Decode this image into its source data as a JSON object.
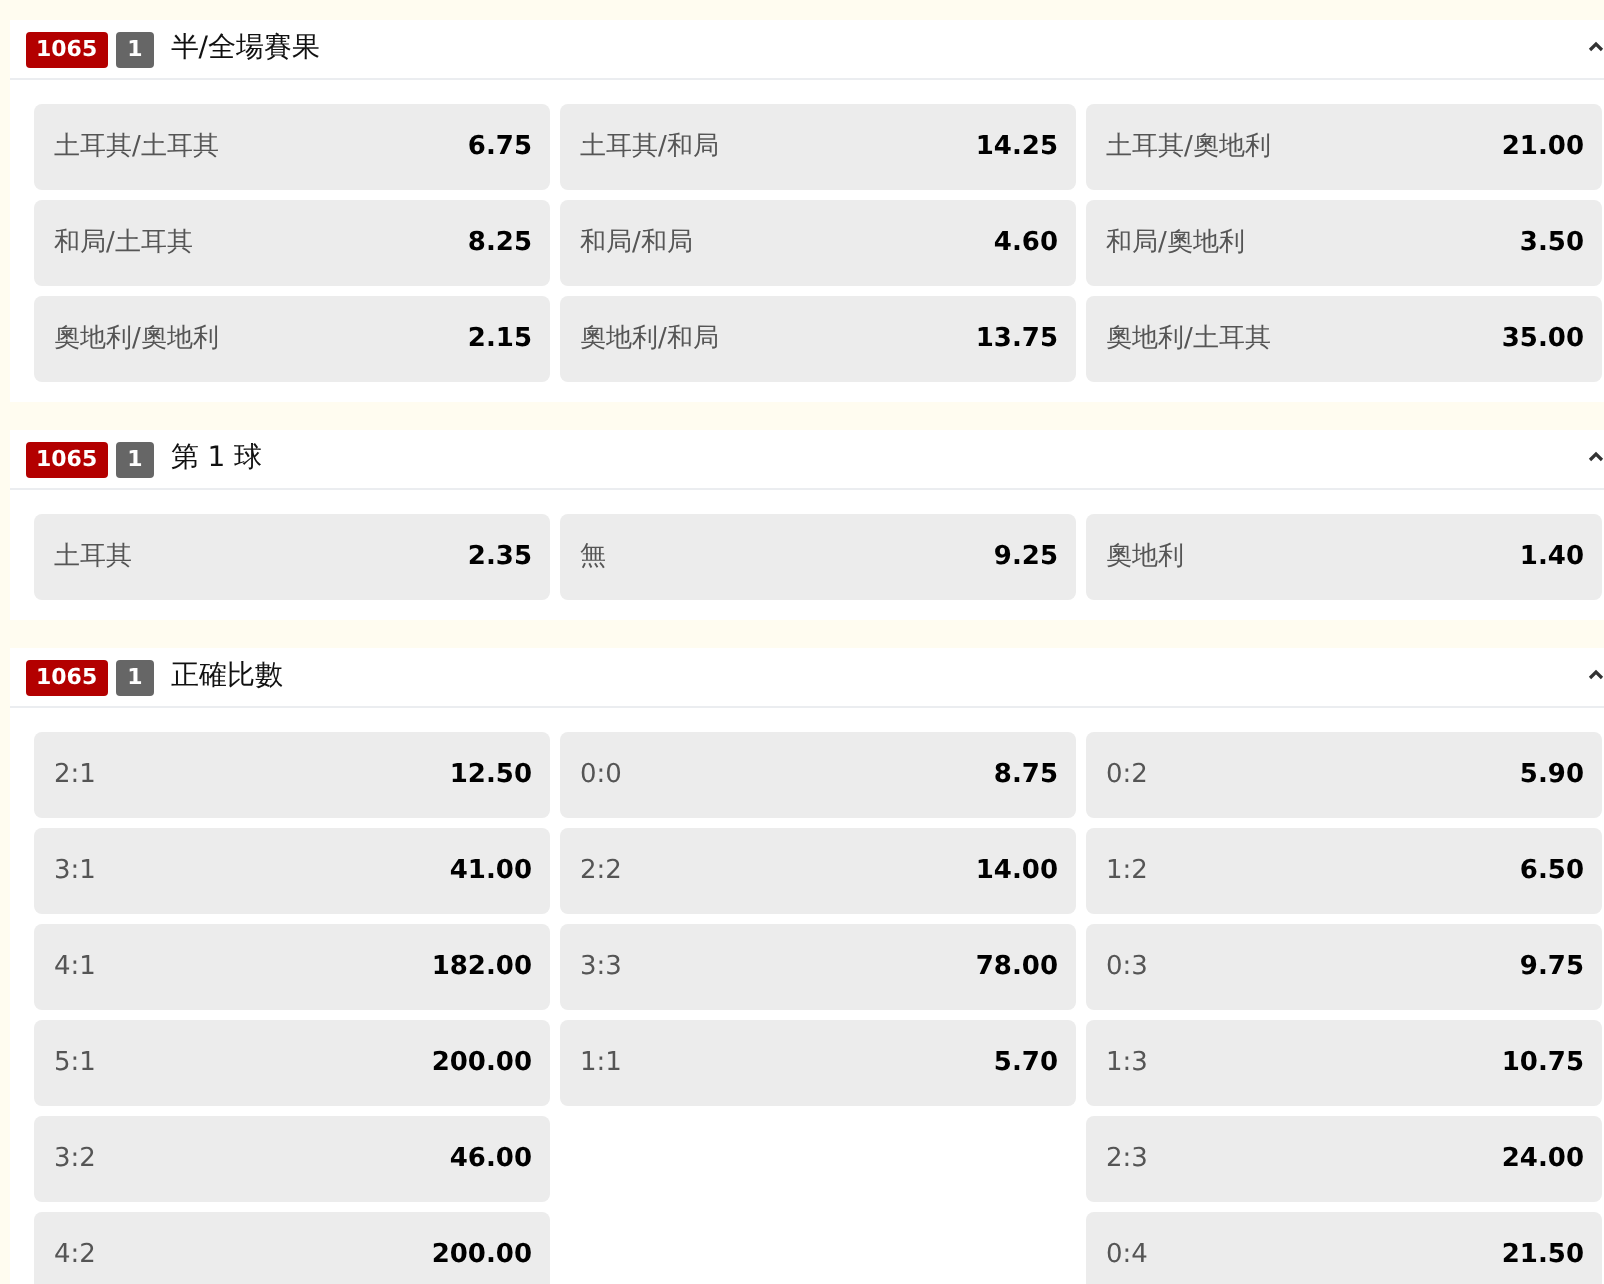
{
  "markets": [
    {
      "code": "1065",
      "count": "1",
      "title": "半/全場賽果",
      "expanded": true,
      "columns": [
        [
          {
            "label": "土耳其/土耳其",
            "odds": "6.75"
          },
          {
            "label": "和局/土耳其",
            "odds": "8.25"
          },
          {
            "label": "奧地利/奧地利",
            "odds": "2.15"
          }
        ],
        [
          {
            "label": "土耳其/和局",
            "odds": "14.25"
          },
          {
            "label": "和局/和局",
            "odds": "4.60"
          },
          {
            "label": "奧地利/和局",
            "odds": "13.75"
          }
        ],
        [
          {
            "label": "土耳其/奧地利",
            "odds": "21.00"
          },
          {
            "label": "和局/奧地利",
            "odds": "3.50"
          },
          {
            "label": "奧地利/土耳其",
            "odds": "35.00"
          }
        ]
      ]
    },
    {
      "code": "1065",
      "count": "1",
      "title": "第 1 球",
      "expanded": true,
      "columns": [
        [
          {
            "label": "土耳其",
            "odds": "2.35"
          }
        ],
        [
          {
            "label": "無",
            "odds": "9.25"
          }
        ],
        [
          {
            "label": "奧地利",
            "odds": "1.40"
          }
        ]
      ]
    },
    {
      "code": "1065",
      "count": "1",
      "title": "正確比數",
      "expanded": true,
      "columns": [
        [
          {
            "label": "2:1",
            "odds": "12.50"
          },
          {
            "label": "3:1",
            "odds": "41.00"
          },
          {
            "label": "4:1",
            "odds": "182.00"
          },
          {
            "label": "5:1",
            "odds": "200.00"
          },
          {
            "label": "3:2",
            "odds": "46.00"
          },
          {
            "label": "4:2",
            "odds": "200.00"
          }
        ],
        [
          {
            "label": "0:0",
            "odds": "8.75"
          },
          {
            "label": "2:2",
            "odds": "14.00"
          },
          {
            "label": "3:3",
            "odds": "78.00"
          },
          {
            "label": "1:1",
            "odds": "5.70"
          }
        ],
        [
          {
            "label": "0:2",
            "odds": "5.90"
          },
          {
            "label": "1:2",
            "odds": "6.50"
          },
          {
            "label": "0:3",
            "odds": "9.75"
          },
          {
            "label": "1:3",
            "odds": "10.75"
          },
          {
            "label": "2:3",
            "odds": "24.00"
          },
          {
            "label": "0:4",
            "odds": "21.50"
          }
        ]
      ]
    }
  ]
}
